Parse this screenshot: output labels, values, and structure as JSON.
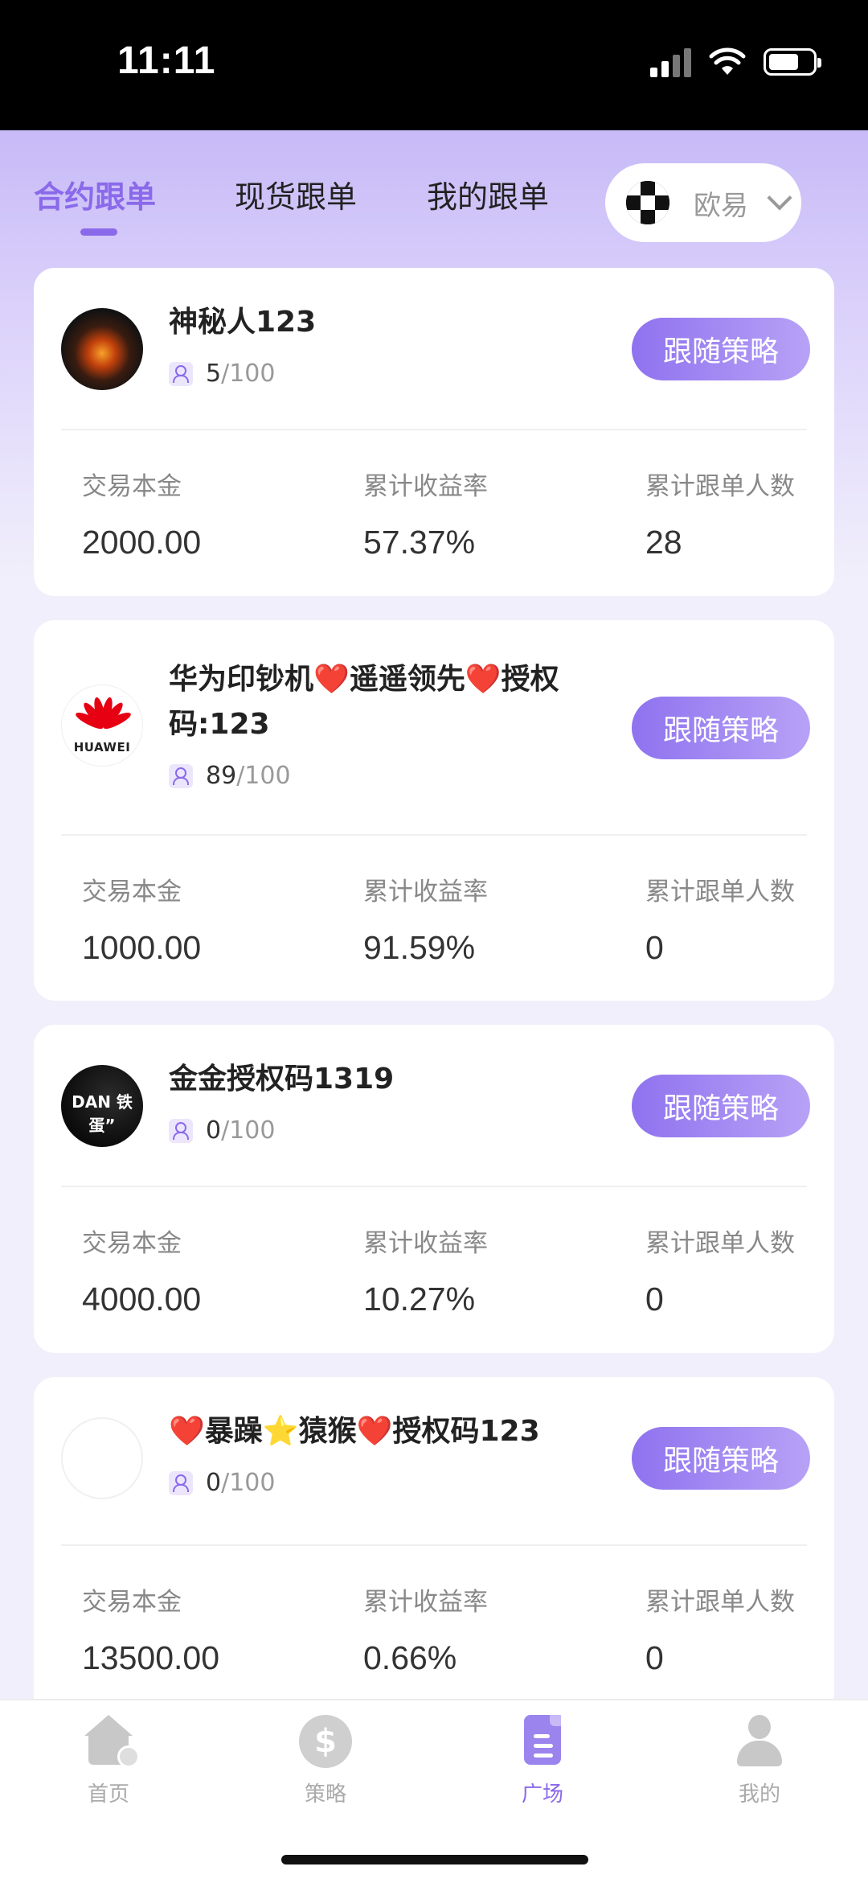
{
  "status_bar": {
    "time": "11:11"
  },
  "tabs": [
    {
      "label": "合约跟单",
      "active": true
    },
    {
      "label": "现货跟单",
      "active": false
    },
    {
      "label": "我的跟单",
      "active": false
    }
  ],
  "exchange": {
    "label": "欧易",
    "icon": "okx-logo-icon"
  },
  "stat_labels": {
    "principal": "交易本金",
    "return_rate": "累计收益率",
    "followers_total": "累计跟单人数"
  },
  "follow_label": "跟随策略",
  "cards": [
    {
      "name_line1": "神秘人123",
      "name_line2": "",
      "followers": "5",
      "capacity": "/100",
      "principal": "2000.00",
      "return_rate": "57.37%",
      "followers_total": "28",
      "avatar": "bull-avatar"
    },
    {
      "name_line1": "华为印钞机❤️遥遥领先❤️授权",
      "name_line2": "码:123",
      "followers": "89",
      "capacity": "/100",
      "principal": "1000.00",
      "return_rate": "91.59%",
      "followers_total": "0",
      "avatar": "huawei-logo-avatar",
      "avatar_text": "HUAWEI"
    },
    {
      "name_line1": "金金授权码1319",
      "name_line2": "",
      "followers": "0",
      "capacity": "/100",
      "principal": "4000.00",
      "return_rate": "10.27%",
      "followers_total": "0",
      "avatar": "dark-avatar",
      "avatar_text": "DAN 铁蛋”"
    },
    {
      "name_line1": "❤️暴躁⭐猿猴❤️授权码123",
      "name_line2": "",
      "followers": "0",
      "capacity": "/100",
      "principal": "13500.00",
      "return_rate": "0.66%",
      "followers_total": "0",
      "avatar": "blank-avatar"
    }
  ],
  "bottom_nav": [
    {
      "label": "首页",
      "icon": "home-icon",
      "active": false
    },
    {
      "label": "策略",
      "icon": "dollar-icon",
      "active": false
    },
    {
      "label": "广场",
      "icon": "document-icon",
      "active": true
    },
    {
      "label": "我的",
      "icon": "user-icon",
      "active": false
    }
  ],
  "colors": {
    "accent": "#8a69ea",
    "button_start": "#8f72ef",
    "button_end": "#b7a2f6"
  }
}
